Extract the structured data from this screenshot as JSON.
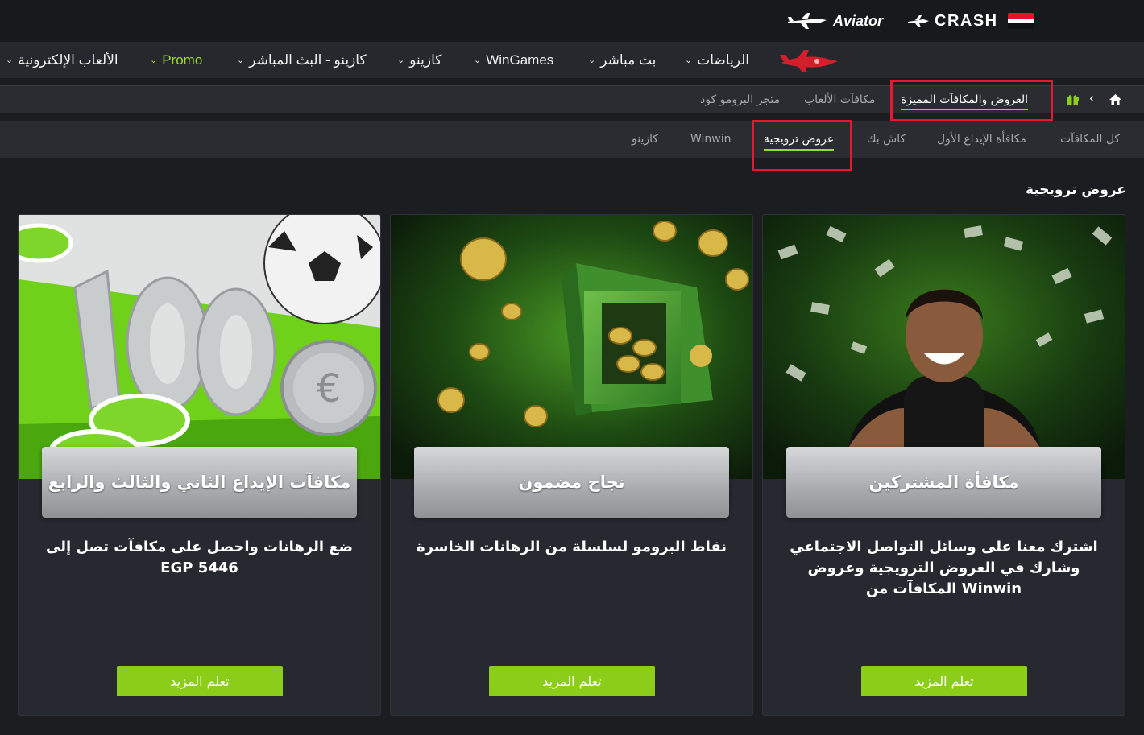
{
  "top": {
    "brand_crash": "CRASH",
    "brand_aviator": "Aviator"
  },
  "nav": {
    "sports": "الرياضات",
    "live": "بث مباشر",
    "wingames": "WinGames",
    "casino": "كازينو",
    "live_casino": "كازينو - البث المباشر",
    "promo": "Promo",
    "egames": "الألعاب الإلكترونية"
  },
  "subnav": {
    "offers": "العروض والمكافآت المميزة",
    "game_bonuses": "مكافآت الألعاب",
    "promo_store": "متجر البرومو كود"
  },
  "tabs": {
    "all": "كل المكافآت",
    "first_deposit": "مكافأة الإيداع الأول",
    "cashback": "كاش بك",
    "promotions": "عروض ترويجية",
    "winwin": "Winwin",
    "casino": "كازينو"
  },
  "section_title": "عروض ترويجية",
  "cards": [
    {
      "title": "مكافأة المشتركين",
      "description": "اشترك معنا على وسائل التواصل الاجتماعي وشارك في العروض الترويجية وعروض المكافآت من Winwin",
      "button": "تعلم المزيد"
    },
    {
      "title": "نجاح مضمون",
      "description": "نقاط البرومو لسلسلة من الرهانات الخاسرة",
      "button": "تعلم المزيد"
    },
    {
      "title": "مكافآت الإيداع الثاني والثالث والرابع",
      "description": "ضع الرهانات واحصل على مكافآت تصل إلى EGP 5446",
      "button": "تعلم المزيد"
    }
  ],
  "colors": {
    "accent": "#9bdc2a",
    "button": "#8ccd1a",
    "highlight_box": "#e8162f"
  }
}
